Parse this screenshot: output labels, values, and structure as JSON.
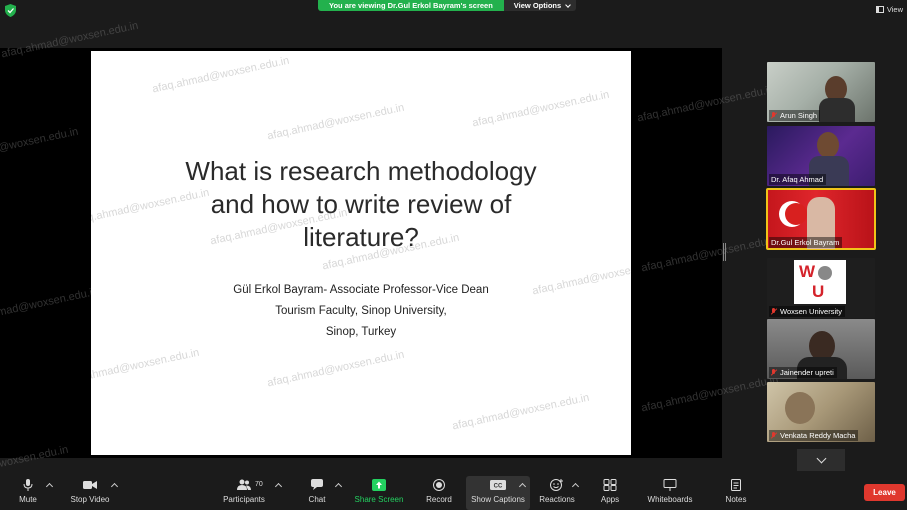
{
  "top_bar": {
    "banner_text": "You are viewing Dr.Gul Erkol Bayram's screen",
    "view_options_label": "View Options",
    "view_label": "View"
  },
  "slide": {
    "title_line1": "What is research methodology",
    "title_line2": "and how to write review of",
    "title_line3": "literature?",
    "author_line1": "Gül Erkol Bayram- Associate Professor-Vice Dean",
    "author_line2": "Tourism Faculty, Sinop University,",
    "author_line3": "Sinop, Turkey"
  },
  "watermark": "afaq.ahmad@woxsen.edu.in",
  "participants_gallery": [
    {
      "name": "Arun Singh",
      "muted": true,
      "active": false
    },
    {
      "name": "Dr. Afaq Ahmad",
      "muted": false,
      "active": false
    },
    {
      "name": "Dr.Gul Erkol Bayram",
      "muted": false,
      "active": true
    },
    {
      "name": "Woxsen University",
      "muted": true,
      "active": false
    },
    {
      "name": "Jainender upreti",
      "muted": true,
      "active": false
    },
    {
      "name": "Venkata Reddy Macha",
      "muted": true,
      "active": false
    }
  ],
  "toolbar": {
    "mute": "Mute",
    "stop_video": "Stop Video",
    "participants": "Participants",
    "participants_count": "70",
    "chat": "Chat",
    "share_screen": "Share Screen",
    "record": "Record",
    "show_captions": "Show Captions",
    "reactions": "Reactions",
    "apps": "Apps",
    "whiteboards": "Whiteboards",
    "notes": "Notes",
    "leave": "Leave"
  },
  "colors": {
    "banner_green": "#23b14d",
    "share_green": "#23d160",
    "leave_red": "#e0382e",
    "active_speaker": "#f0c419"
  }
}
